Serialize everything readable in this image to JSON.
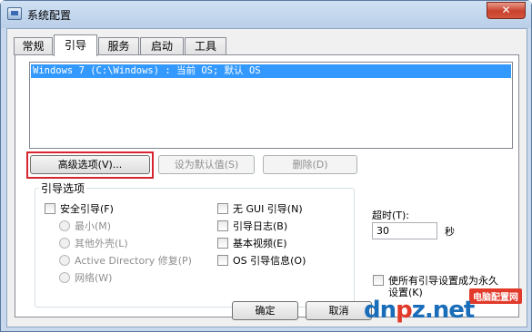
{
  "window": {
    "title": "系统配置",
    "close_glyph": "✕"
  },
  "tabs": [
    {
      "label": "常规"
    },
    {
      "label": "引导"
    },
    {
      "label": "服务"
    },
    {
      "label": "启动"
    },
    {
      "label": "工具"
    }
  ],
  "boot_list": {
    "entries": [
      "Windows 7 (C:\\Windows) : 当前 OS; 默认 OS"
    ]
  },
  "buttons": {
    "advanced": "高级选项(V)...",
    "set_default": "设为默认值(S)",
    "delete": "删除(D)",
    "ok": "确定",
    "cancel": "取消"
  },
  "boot_options": {
    "label": "引导选项",
    "safe_boot": "安全引导(F)",
    "minimal": "最小(M)",
    "alternate_shell": "其他外壳(L)",
    "active_directory": "Active Directory 修复(P)",
    "network": "网络(W)",
    "no_gui": "无 GUI 引导(N)",
    "boot_log": "引导日志(B)",
    "base_video": "基本视频(E)",
    "os_boot_info": "OS 引导信息(O)"
  },
  "timeout": {
    "label": "超时(T):",
    "value": "30",
    "unit": "秒"
  },
  "permanent": {
    "line1": "使所有引导设置成为永久",
    "line2": "设置(K)"
  },
  "watermark": {
    "brand_d": "d",
    "brand_n": "n",
    "brand_p": "p",
    "brand_z": "z",
    "brand_tld": ".net",
    "tag": "电脑配置网"
  }
}
